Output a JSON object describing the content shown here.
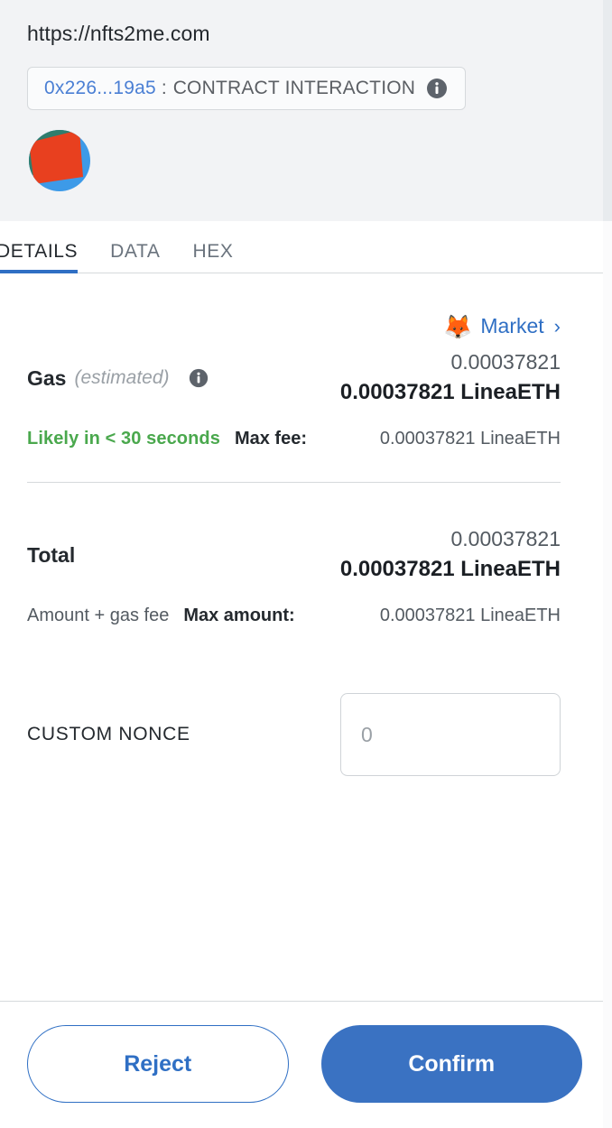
{
  "header": {
    "origin_url": "https://nfts2me.com",
    "address_short": "0x226...19a5",
    "address_separator": ":",
    "interaction_type": "CONTRACT INTERACTION",
    "info_icon": "info-icon",
    "identicon": "account-identicon",
    "identicon_colors": {
      "background": "#3d9ae8",
      "shape": "#e8401f",
      "accent": "#2f7d6d"
    },
    "background_color": "#f2f3f5"
  },
  "tabs": [
    {
      "label": "DETAILS",
      "active": true
    },
    {
      "label": "DATA",
      "active": false
    },
    {
      "label": "HEX",
      "active": false
    }
  ],
  "market": {
    "icon": "fox-icon",
    "label": "Market",
    "chevron": "›",
    "link_color": "#2f6fc4"
  },
  "gas": {
    "label": "Gas",
    "estimated_note": "(estimated)",
    "info_icon": "info-icon",
    "fiat_amount": "0.00037821",
    "native_amount": "0.00037821 LineaETH",
    "speed_text": "Likely in < 30 seconds",
    "speed_color": "#4aa84d",
    "max_fee_label": "Max fee:",
    "max_fee_value": "0.00037821 LineaETH"
  },
  "total": {
    "label": "Total",
    "fiat_amount": "0.00037821",
    "native_amount": "0.00037821 LineaETH",
    "description": "Amount + gas fee",
    "max_amount_label": "Max amount:",
    "max_amount_value": "0.00037821 LineaETH"
  },
  "nonce": {
    "label": "CUSTOM NONCE",
    "value": "",
    "placeholder": "0"
  },
  "footer": {
    "reject_label": "Reject",
    "confirm_label": "Confirm",
    "confirm_color": "#3a72c2",
    "reject_color": "#2f6fc4"
  }
}
